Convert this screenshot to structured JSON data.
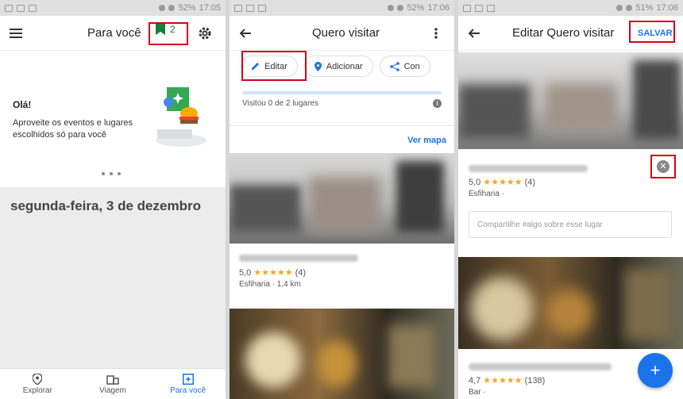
{
  "status": {
    "p1": {
      "battery": "52%",
      "time": "17:05"
    },
    "p2": {
      "battery": "52%",
      "time": "17:06"
    },
    "p3": {
      "battery": "51%",
      "time": "17:06"
    }
  },
  "panel1": {
    "title": "Para você",
    "saved_count": "2",
    "greeting": "Olá!",
    "description": "Aproveite os eventos e lugares escolhidos só para você",
    "date": "segunda-feira, 3 de dezembro",
    "nav": [
      {
        "label": "Explorar",
        "icon": "location-pin-icon"
      },
      {
        "label": "Viagem",
        "icon": "building-icon"
      },
      {
        "label": "Para você",
        "icon": "sparkle-icon"
      }
    ]
  },
  "panel2": {
    "title": "Quero visitar",
    "chips": [
      {
        "label": "Editar",
        "icon": "pencil-icon"
      },
      {
        "label": "Adicionar",
        "icon": "location-pin-icon"
      },
      {
        "label": "Con",
        "icon": "share-icon"
      }
    ],
    "progress_text": "Visitou 0 de 2 lugares",
    "progress_fraction": 0,
    "ver_mapa": "Ver mapa",
    "place1": {
      "rating": "5,0",
      "stars": "★★★★★",
      "reviews": "(4)",
      "category": "Esfiharia · 1,4 km"
    }
  },
  "panel3": {
    "title": "Editar Quero visitar",
    "save_label": "SALVAR",
    "place1": {
      "rating": "5,0",
      "stars": "★★★★★",
      "reviews": "(4)",
      "category": "Esfiharia ·"
    },
    "note_placeholder": "Compartilhe #algo sobre esse lugar",
    "place2": {
      "rating": "4,7",
      "stars": "★★★★★",
      "reviews": "(138)",
      "category": "Bar ·"
    },
    "fab_label": "+"
  },
  "colors": {
    "accent": "#1a73e8",
    "highlight_box": "#d0021b",
    "star": "#f5a623",
    "saved_green": "#188038"
  }
}
